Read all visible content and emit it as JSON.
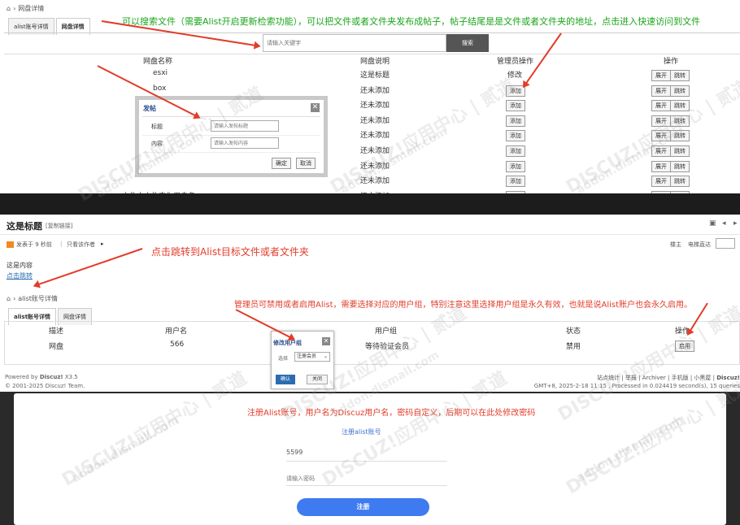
{
  "top": {
    "breadcrumb": "网盘详情",
    "tabs": [
      "alist账号详情",
      "网盘详情"
    ],
    "search_placeholder": "请输入关键字",
    "search_button": "搜索",
    "annotation": "可以搜索文件（需要Alist开启更新检索功能），可以把文件或者文件夹发布成帖子，帖子结尾是是文件或者文件夹的地址，点击进入快速访问到文件",
    "headers": [
      "网盘名称",
      "网盘说明",
      "管理员操作",
      "操作"
    ],
    "rows": [
      {
        "name": "esxi",
        "desc": "这是标题",
        "admin": "修改"
      },
      {
        "name": "box",
        "desc": "还未添加",
        "admin": "添加"
      },
      {
        "name": "",
        "desc": "还未添加",
        "admin": "添加"
      },
      {
        "name": "",
        "desc": "还未添加",
        "admin": "添加"
      },
      {
        "name": "",
        "desc": "还未添加",
        "admin": "添加"
      },
      {
        "name": "",
        "desc": "还未添加",
        "admin": "添加"
      },
      {
        "name": "",
        "desc": "还未添加",
        "admin": "添加"
      },
      {
        "name": "",
        "desc": "还未添加",
        "admin": "添加"
      },
      {
        "name": "文件内文件夹为用户名",
        "desc": "还未添加",
        "admin": "添加"
      }
    ],
    "ops": [
      "展开",
      "跳转"
    ],
    "dialog": {
      "title": "发帖",
      "title_label": "标题",
      "title_placeholder": "请输入发帖标题",
      "content_label": "内容",
      "content_placeholder": "请输入发帖内容",
      "ok": "确定",
      "cancel": "取消"
    }
  },
  "post": {
    "title": "这是标题",
    "copy_link": "[复制链接]",
    "meta_posted": "发表于 9 秒前",
    "meta_author_only": "只看该作者",
    "floor": "楼主",
    "jump_to": "电梯直达",
    "content": "这是内容",
    "link": "点击跳转",
    "annotation": "点击跳转到Alist目标文件或者文件夹"
  },
  "account": {
    "breadcrumb": "alist账号详情",
    "tabs": [
      "alist账号详情",
      "网盘详情"
    ],
    "headers": [
      "描述",
      "用户名",
      "用户组",
      "状态",
      "操作"
    ],
    "row": {
      "desc": "网盘",
      "user": "566",
      "group": "等待验证会员",
      "status": "禁用",
      "op": "启用"
    },
    "annotation": "管理员可禁用或者启用Alist，需要选择对应的用户组，特别注意这里选择用户组是永久有效，也就是说Alist账户也会永久启用。",
    "dialog": {
      "title": "修改用户组",
      "label": "选择",
      "selected": "注册会员",
      "ok": "确认",
      "cancel": "关闭"
    },
    "footer_powered": "Powered by",
    "footer_brand": "Discuz!",
    "footer_version": "X3.5",
    "footer_copy": "© 2001-2025 Discuz! Team.",
    "footer_links": "站点统计 | 举报 | Archiver | 手机版 | 小黑屋 |",
    "footer_brand2": "Discuz! ",
    "footer_time": "GMT+8, 2025-2-18 11:15 , Processed in 0.024419 second(s), 15 queries"
  },
  "register": {
    "annotation": "注册Alist账号，用户名为Discuz用户名，密码自定义，后期可以在此处修改密码",
    "title": "注册alist账号",
    "username": "5599",
    "password_placeholder": "请输入密码",
    "submit": "注册"
  },
  "watermark": {
    "main": "DISCUZ!应用中心 | 贰道",
    "sub": "addon.dismall.com"
  },
  "colors": {
    "annotation_green": "#1aa51a",
    "annotation_red": "#e23c2a",
    "primary_blue": "#3f7bf0",
    "discuz_blue": "#2b6cb0"
  }
}
